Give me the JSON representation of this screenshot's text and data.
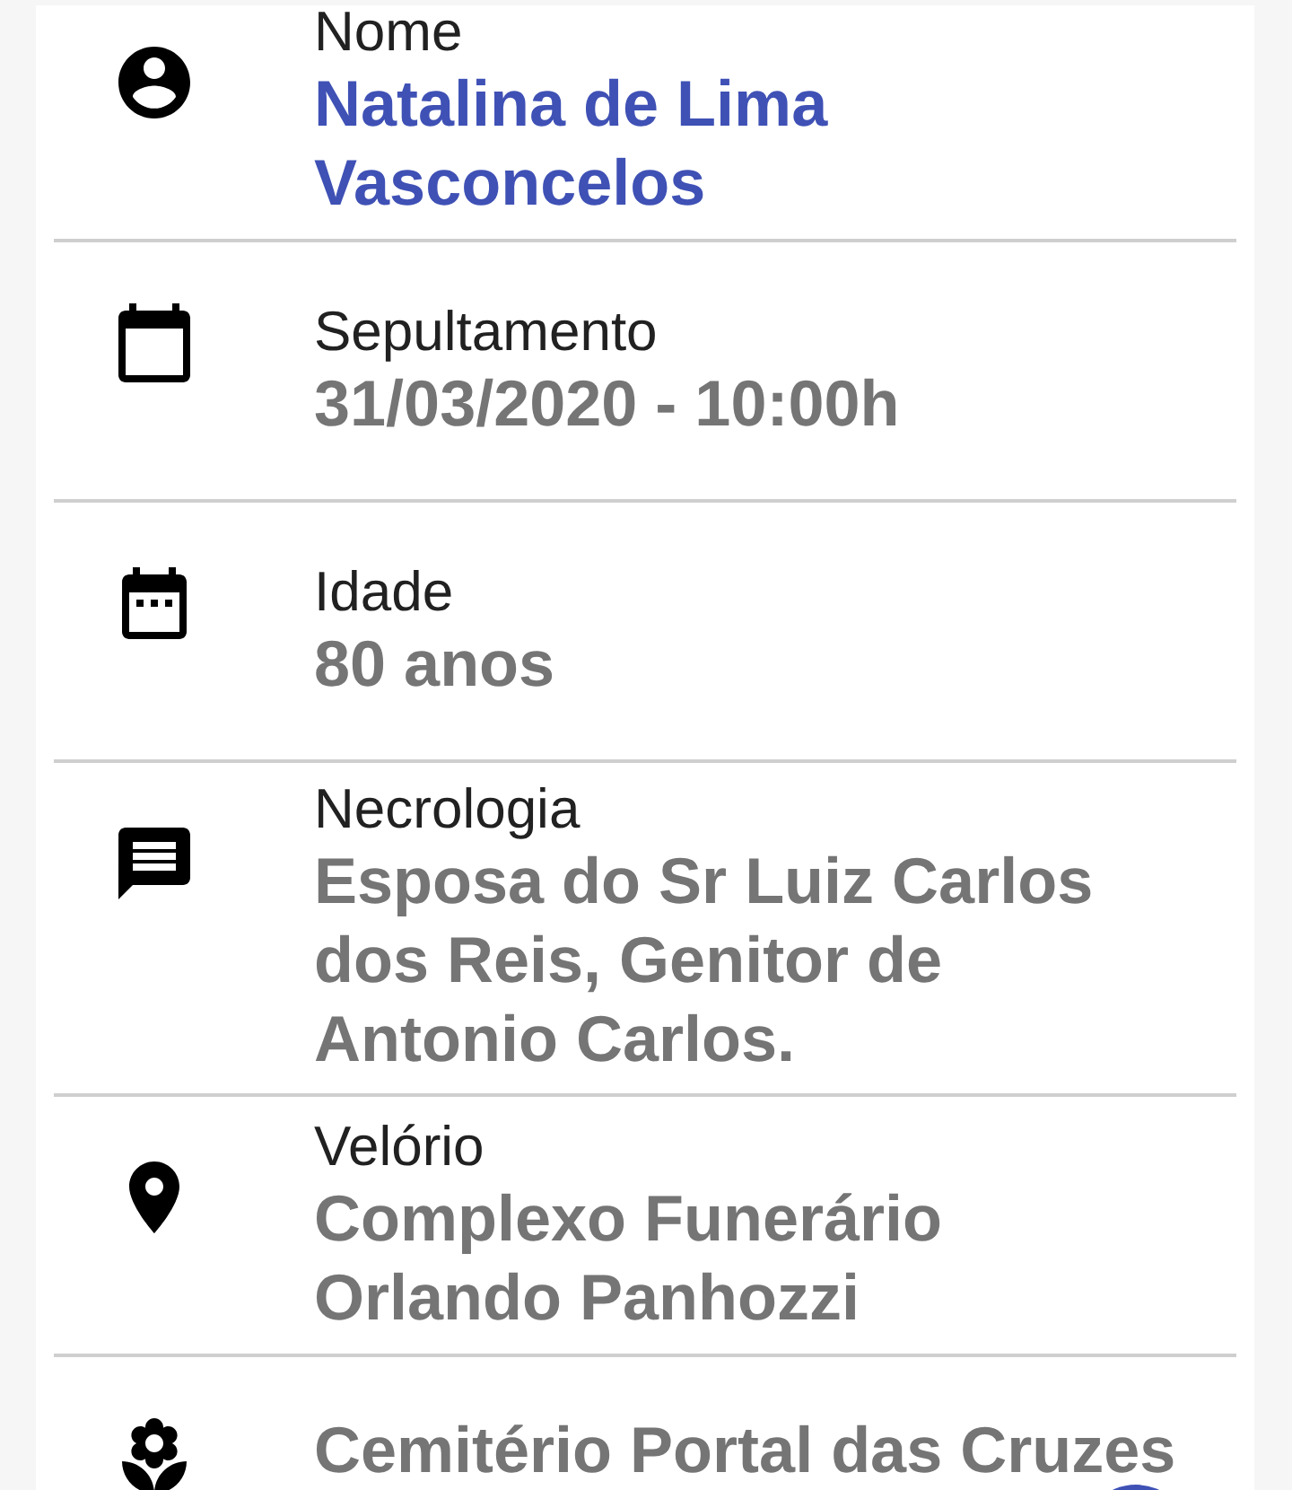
{
  "details": [
    {
      "kind": "person",
      "label": "Nome",
      "value": "Natalina de Lima Vasconcelos",
      "highlighted": true
    },
    {
      "kind": "calendar",
      "label": "Sepultamento",
      "value": "31/03/2020 - 10:00h",
      "highlighted": false
    },
    {
      "kind": "calendar-dots",
      "label": "Idade",
      "value": "80 anos",
      "highlighted": false
    },
    {
      "kind": "message",
      "label": "Necrologia",
      "value": "Esposa do Sr Luiz Carlos dos Reis, Genitor de Antonio Carlos.",
      "highlighted": false
    },
    {
      "kind": "pin",
      "label": "Velório",
      "value": "Complexo Funerário Orlando Panhozzi",
      "highlighted": false
    },
    {
      "kind": "flower",
      "value": "Cemitério Portal das Cruzes",
      "highlighted": false
    }
  ]
}
